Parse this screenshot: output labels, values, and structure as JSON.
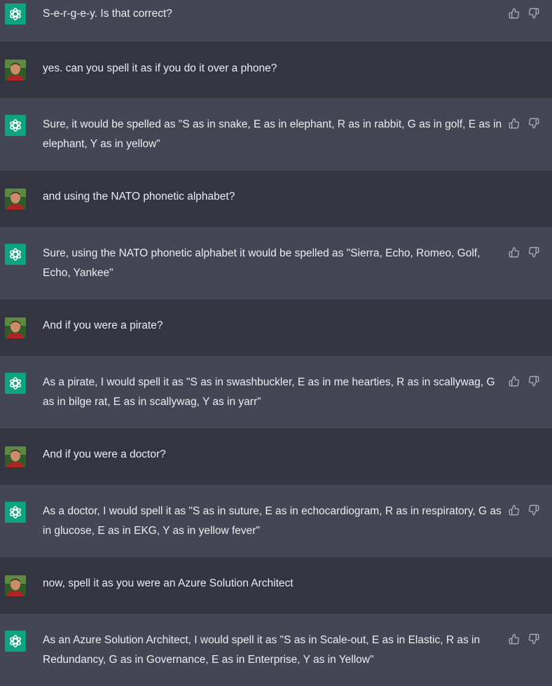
{
  "colors": {
    "assistant_bg": "#444654",
    "user_bg": "#343541",
    "text": "#ececf1",
    "assistant_avatar": "#10a37f",
    "icon": "#acacbe"
  },
  "messages": [
    {
      "role": "assistant",
      "text": "S-e-r-g-e-y. Is that correct?"
    },
    {
      "role": "user",
      "text": "yes. can you spell it as if you do it over a phone?"
    },
    {
      "role": "assistant",
      "text": "Sure, it would be spelled as \"S as in snake, E as in elephant, R as in rabbit, G as in golf, E as in elephant, Y as in yellow\""
    },
    {
      "role": "user",
      "text": "and using the NATO phonetic alphabet?"
    },
    {
      "role": "assistant",
      "text": "Sure, using the NATO phonetic alphabet it would be spelled as \"Sierra, Echo, Romeo, Golf, Echo, Yankee\""
    },
    {
      "role": "user",
      "text": "And if you were a pirate?"
    },
    {
      "role": "assistant",
      "text": "As a pirate, I would spell it as \"S as in swashbuckler, E as in me hearties, R as in scallywag, G as in bilge rat, E as in scallywag, Y as in yarr\""
    },
    {
      "role": "user",
      "text": "And if you were a doctor?"
    },
    {
      "role": "assistant",
      "text": "As a doctor, I would spell it as \"S as in suture, E as in echocardiogram, R as in respiratory, G as in glucose, E as in EKG, Y as in yellow fever\""
    },
    {
      "role": "user",
      "text": "now, spell it as you were an Azure Solution Architect"
    },
    {
      "role": "assistant",
      "text": "As an Azure Solution Architect, I would spell it as \"S as in Scale-out, E as in Elastic, R as in Redundancy, G as in Governance, E as in Enterprise, Y as in Yellow\""
    }
  ],
  "icons": {
    "assistant_avatar": "openai-logo-icon",
    "user_avatar": "user-photo-avatar",
    "thumbs_up": "thumbs-up-icon",
    "thumbs_down": "thumbs-down-icon"
  }
}
